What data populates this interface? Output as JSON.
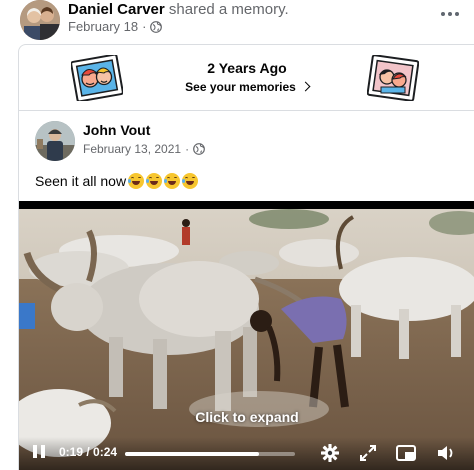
{
  "post": {
    "author": "Daniel Carver",
    "action": "shared a memory.",
    "date": "February 18",
    "audience_icon": "globe-icon"
  },
  "memory": {
    "title": "2 Years Ago",
    "link": "See your memories"
  },
  "inner_post": {
    "author": "John Vout",
    "date": "February 13, 2021",
    "audience_icon": "globe-icon",
    "text": "Seen it all now",
    "emoji_count": 4,
    "emoji_name": "laughing-tears-emoji"
  },
  "video": {
    "overlay_label": "Click to expand",
    "time": "0:19 / 0:24",
    "progress": 0.79
  },
  "colors": {
    "text_primary": "#050505",
    "text_secondary": "#65676b",
    "border": "#dadde1"
  }
}
